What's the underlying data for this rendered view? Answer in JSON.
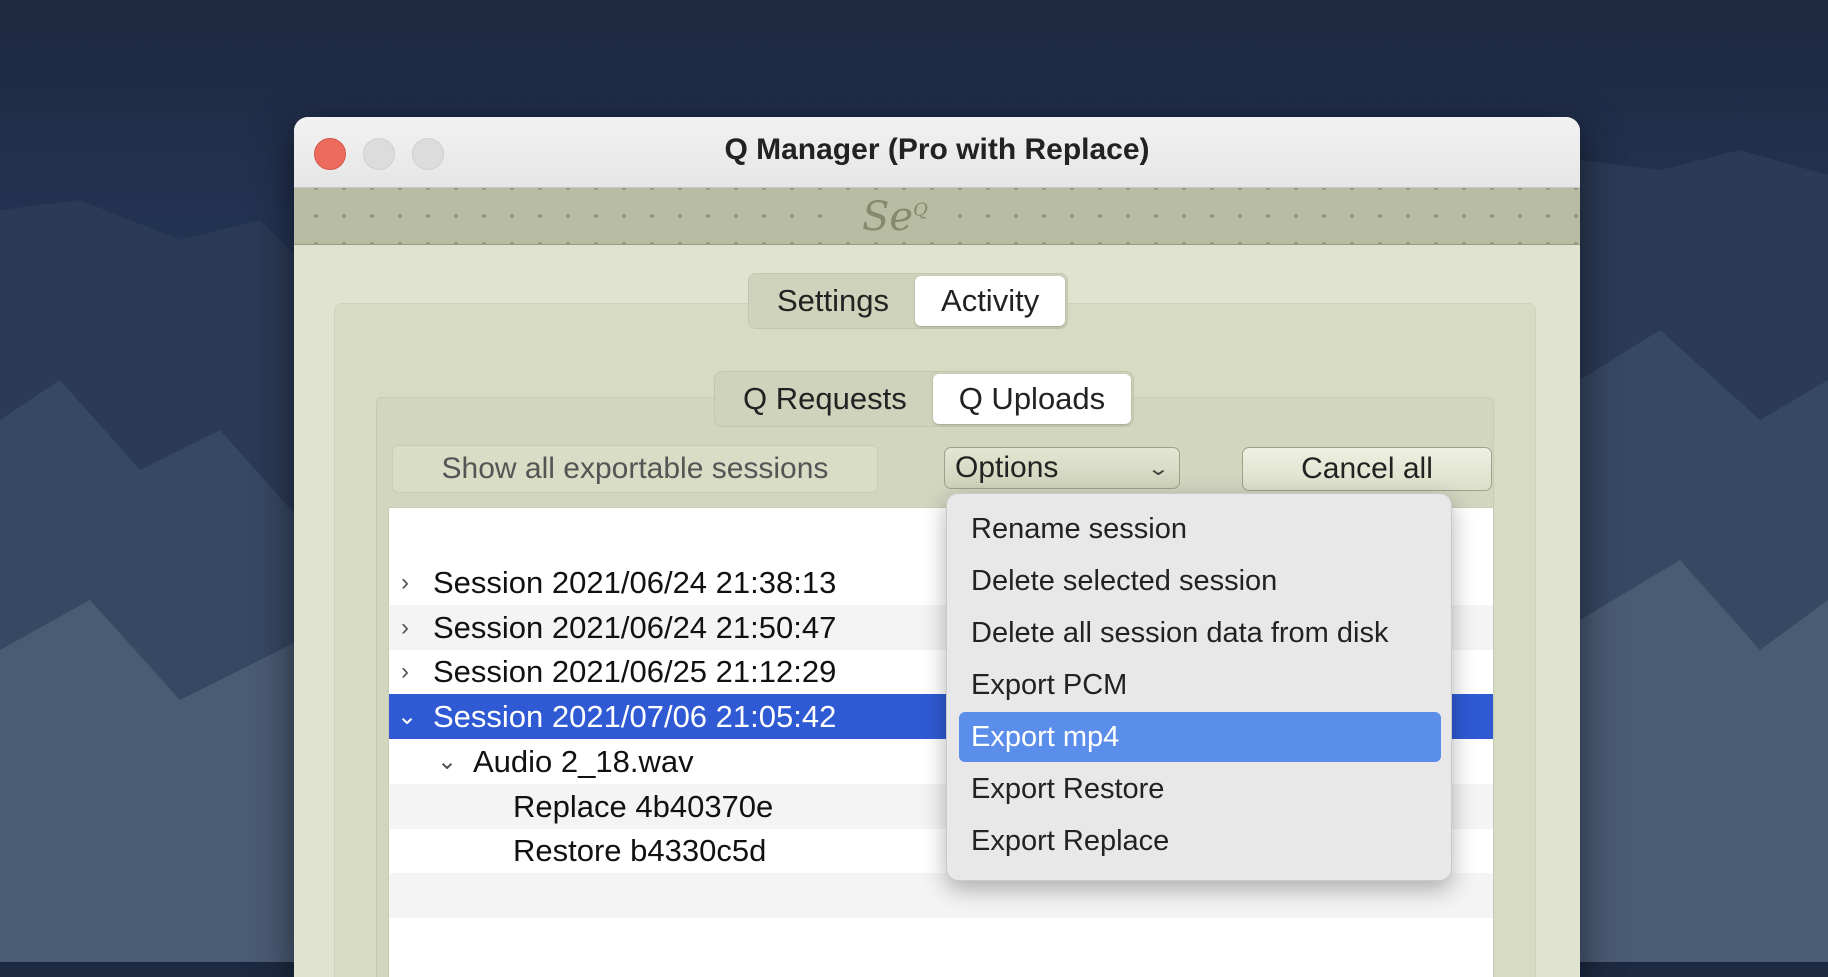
{
  "window": {
    "title": "Q Manager (Pro with Replace)"
  },
  "banner": {
    "logo_text": "Se",
    "logo_sup": "Q"
  },
  "main_tabs": [
    {
      "label": "Settings",
      "active": false
    },
    {
      "label": "Activity",
      "active": true
    }
  ],
  "sub_tabs": [
    {
      "label": "Q Requests",
      "active": false
    },
    {
      "label": "Q Uploads",
      "active": true
    }
  ],
  "toolbar": {
    "show_all_label": "Show all exportable sessions",
    "options_label": "Options",
    "cancel_all_label": "Cancel all"
  },
  "sessions": [
    {
      "label": "Session 2021/06/24 21:38:13",
      "expanded": false,
      "selected": false
    },
    {
      "label": "Session 2021/06/24 21:50:47",
      "expanded": false,
      "selected": false
    },
    {
      "label": "Session 2021/06/25 21:12:29",
      "expanded": false,
      "selected": false
    },
    {
      "label": "Session 2021/07/06 21:05:42",
      "expanded": true,
      "selected": true
    }
  ],
  "session_children": {
    "file": "Audio 2_18.wav",
    "items": [
      "Replace 4b40370e",
      "Restore b4330c5d"
    ]
  },
  "options_menu": {
    "items": [
      "Rename session",
      "Delete selected session",
      "Delete all session data from disk",
      "Export PCM",
      "Export mp4",
      "Export Restore",
      "Export Replace"
    ],
    "highlighted": "Export mp4"
  },
  "colors": {
    "selection": "#2f5ad4",
    "menu_highlight": "#5b8eeb",
    "panel_bg": "#dfe3cf",
    "close_button": "#ed6a5e"
  }
}
